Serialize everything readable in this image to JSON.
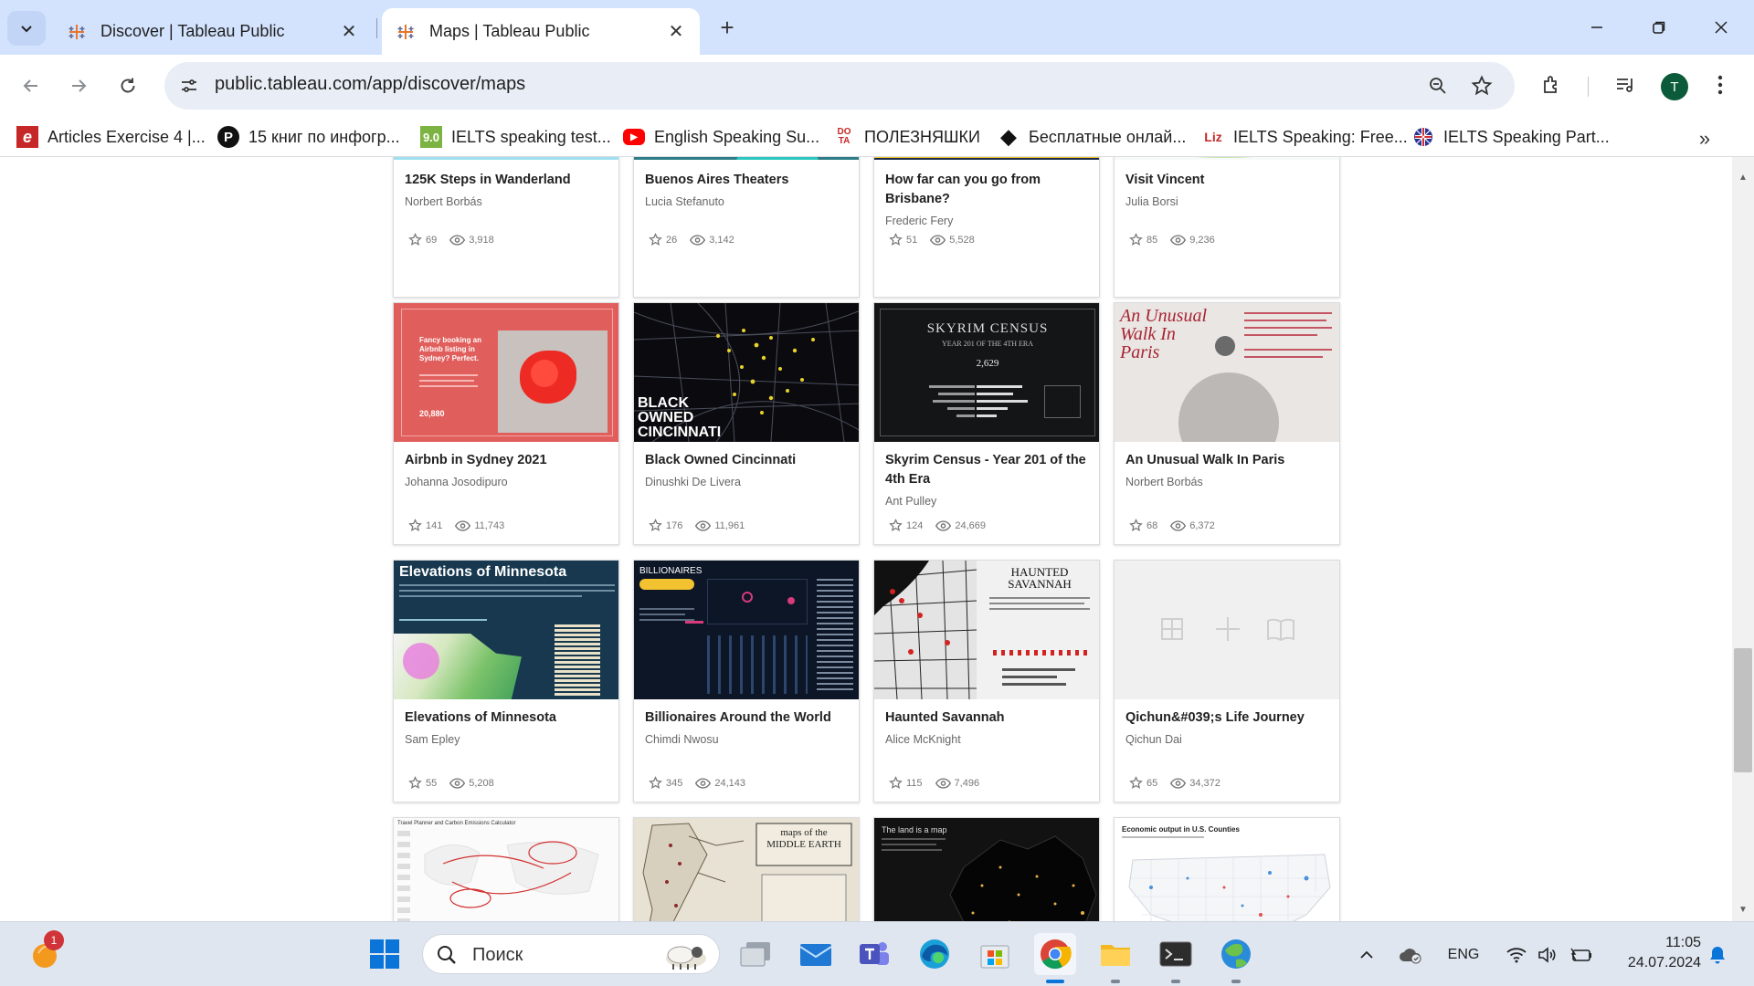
{
  "tabs": [
    {
      "title": "Discover | Tableau Public",
      "active": false
    },
    {
      "title": "Maps | Tableau Public",
      "active": true
    }
  ],
  "address_bar": {
    "url": "public.tableau.com/app/discover/maps"
  },
  "profile_initial": "T",
  "bookmarks": [
    {
      "label": "Articles Exercise 4 |...",
      "icon_text": "e",
      "color": "#c62828"
    },
    {
      "label": "15 книг по инфогр...",
      "icon_text": "P",
      "color": "#111111"
    },
    {
      "label": "IELTS speaking test...",
      "icon_text": "9.0",
      "color": "#7cb342"
    },
    {
      "label": "English Speaking Su...",
      "icon_text": "▶",
      "color": "#ff0000"
    },
    {
      "label": "ПОЛЕЗНЯШКИ",
      "icon_text": "DOTA",
      "color": "#c62828"
    },
    {
      "label": "Бесплатные онлай...",
      "icon_text": "◆",
      "color": "#111111"
    },
    {
      "label": "IELTS Speaking: Free...",
      "icon_text": "Liz",
      "color": "#c62828"
    },
    {
      "label": "IELTS Speaking Part...",
      "icon_text": "UK",
      "color": "#283593"
    }
  ],
  "vizzes": [
    {
      "title": "125K Steps in Wanderland",
      "author": "Norbert Borbás",
      "favorites": "69",
      "views": "3,918"
    },
    {
      "title": "Buenos Aires Theaters",
      "author": "Lucia Stefanuto",
      "favorites": "26",
      "views": "3,142"
    },
    {
      "title": "How far can you go from Brisbane?",
      "author": "Frederic Fery",
      "favorites": "51",
      "views": "5,528"
    },
    {
      "title": "Visit Vincent",
      "author": "Julia Borsi",
      "favorites": "85",
      "views": "9,236"
    },
    {
      "title": "Airbnb in Sydney 2021",
      "author": "Johanna Josodipuro",
      "favorites": "141",
      "views": "11,743"
    },
    {
      "title": "Black Owned Cincinnati",
      "author": "Dinushki De Livera",
      "favorites": "176",
      "views": "11,961"
    },
    {
      "title": "Skyrim Census - Year 201 of the 4th Era",
      "author": "Ant Pulley",
      "favorites": "124",
      "views": "24,669"
    },
    {
      "title": "An Unusual Walk In Paris",
      "author": "Norbert Borbás",
      "favorites": "68",
      "views": "6,372"
    },
    {
      "title": "Elevations of Minnesota",
      "author": "Sam Epley",
      "favorites": "55",
      "views": "5,208"
    },
    {
      "title": "Billionaires Around the World",
      "author": "Chimdi Nwosu",
      "favorites": "345",
      "views": "24,143"
    },
    {
      "title": "Haunted Savannah",
      "author": "Alice McKnight",
      "favorites": "115",
      "views": "7,496"
    },
    {
      "title": "Qichun&#039;s Life Journey",
      "author": "Qichun Dai",
      "favorites": "65",
      "views": "34,372"
    }
  ],
  "thumb_text": {
    "cincinnati": "BLACK OWNED CINCINNATI",
    "skyrim_title": "SKYRIM CENSUS",
    "skyrim_sub": "YEAR 201 OF THE 4TH ERA",
    "skyrim_num": "2,629",
    "paris": "An Unusual Walk In Paris",
    "minnesota": "Elevations of Minnesota",
    "billionaires": "BILLIONAIRES",
    "savannah": "HAUNTED SAVANNAH",
    "airbnb": "Fancy booking an Airbnb listing in Sydney? Perfect.",
    "airbnb_num": "20,880",
    "travel": "Travel Planner and Carbon Emissions Calculator",
    "earth": "maps of the MIDDLE EARTH",
    "land": "The land is a map",
    "econ": "Economic output in U.S. Counties"
  },
  "taskbar": {
    "search_placeholder": "Поиск",
    "notification_count": "1",
    "language": "ENG",
    "time": "11:05",
    "date": "24.07.2024"
  },
  "colors": {
    "tab_strip": "#d3e3fd",
    "accent": "#0b57d0"
  }
}
